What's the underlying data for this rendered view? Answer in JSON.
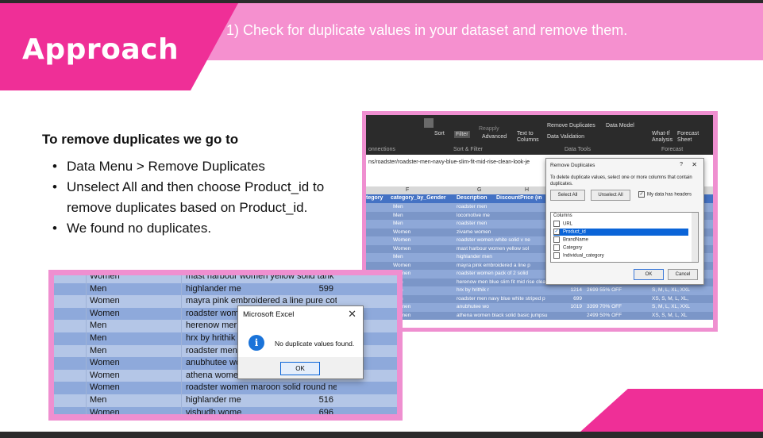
{
  "header": {
    "title": "Approach",
    "subtitle": "1) Check for duplicate values in your dataset and remove them."
  },
  "body": {
    "heading": "To remove duplicates we go to",
    "bullets": [
      "Data Menu > Remove Duplicates",
      "Unselect All and then choose Product_id to remove duplicates based on Product_id.",
      "We found no duplicates."
    ]
  },
  "right_shot": {
    "ribbon": {
      "sort": "Sort",
      "filter": "Filter",
      "reapply": "Reapply",
      "advanced": "Advanced",
      "text_to_columns": "Text to Columns",
      "remove_duplicates": "Remove Duplicates",
      "data_validation": "Data Validation",
      "data_model": "Data Model",
      "what_if": "What-If Analysis",
      "forecast_sheet": "Forecast Sheet",
      "group_sort_filter": "Sort & Filter",
      "group_data_tools": "Data Tools",
      "group_forecast": "Forecast",
      "connections": "onnections"
    },
    "url_text": "ns/roadster/roadster-men-navy-blue-slim-fit-mid-rise-clean-look-je",
    "columns": [
      "F",
      "G",
      "H"
    ],
    "headers": [
      "tegory",
      "category_by_Gender",
      "Description",
      "DiscountPrice (in"
    ],
    "rows": [
      [
        "Men",
        "roadster men",
        "",
        "",
        "34,"
      ],
      [
        "Men",
        "locomotive me",
        "",
        "",
        ""
      ],
      [
        "Men",
        "roadster men",
        "",
        "",
        "44,"
      ],
      [
        "Women",
        "zivame women",
        "",
        "",
        "XXL"
      ],
      [
        "Women",
        "roadster women white solid v ne",
        "",
        "",
        "XL"
      ],
      [
        "Women",
        "mast harbour women yellow sol",
        "",
        "",
        "XL"
      ],
      [
        "Men",
        "highlander men",
        "",
        "",
        "36"
      ],
      [
        "Women",
        "mayra pink embroidered a line p",
        "",
        "",
        "XL"
      ],
      [
        "Women",
        "roadster women pack of 2 solid",
        "",
        "",
        "XL"
      ],
      [
        "Men",
        "herenow men blue slim fit mid rise clea",
        "2749",
        "",
        "28, 30, 32, 34,"
      ],
      [
        "Men",
        "hrx by hrithik r",
        "1214",
        "2699 55% OFF",
        "S, M, L, XL, XXL"
      ],
      [
        "Men",
        "roadster men navy blue white striped p",
        "699",
        "",
        "XS, S, M, L, XL,"
      ],
      [
        "Women",
        "anubhutee wo",
        "1019",
        "3399 70% OFF",
        "S, M, L, XL, XXL"
      ],
      [
        "Women",
        "athena women black solid basic jumpsu",
        "",
        "2499 50% OFF",
        "XS, S, M, L, XL"
      ]
    ],
    "dialog": {
      "title": "Remove Duplicates",
      "help": "?",
      "close": "✕",
      "description": "To delete duplicate values, select one or more columns that contain duplicates.",
      "select_all": "Select All",
      "unselect_all": "Unselect All",
      "has_headers": "My data has headers",
      "columns_label": "Columns",
      "columns": [
        "URL",
        "Product_id",
        "BrandName",
        "Category",
        "Individual_category"
      ],
      "selected_column": "Product_id",
      "ok": "OK",
      "cancel": "Cancel"
    }
  },
  "left_shot": {
    "rows": [
      [
        "Women",
        "mast harbour women yellow solid tank",
        ""
      ],
      [
        "Men",
        "highlander me",
        "599"
      ],
      [
        "Women",
        "mayra pink embroidered a line pure cot",
        ""
      ],
      [
        "Women",
        "roadster wom",
        ""
      ],
      [
        "Men",
        "herenow mer",
        ""
      ],
      [
        "Men",
        "hrx by hrithik",
        ""
      ],
      [
        "Men",
        "roadster men",
        ""
      ],
      [
        "Women",
        "anubhutee wo",
        ""
      ],
      [
        "Women",
        "athena wome",
        ""
      ],
      [
        "Women",
        "roadster women maroon solid round ne",
        ""
      ],
      [
        "Men",
        "highlander me",
        "516"
      ],
      [
        "Women",
        "vishudh wome",
        "696"
      ]
    ],
    "dialog": {
      "title": "Microsoft Excel",
      "close": "✕",
      "icon": "i",
      "message": "No duplicate values found.",
      "ok": "OK"
    }
  }
}
